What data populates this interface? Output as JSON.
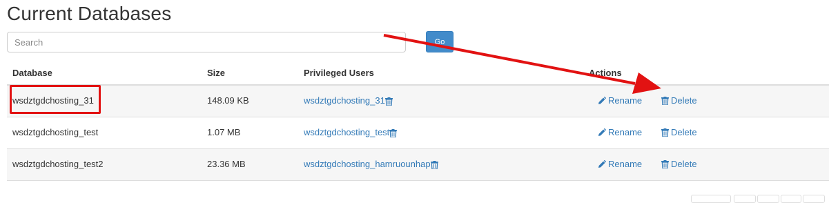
{
  "page": {
    "title": "Current Databases"
  },
  "search": {
    "placeholder": "Search",
    "value": "",
    "go_label": "Go"
  },
  "table": {
    "headers": {
      "database": "Database",
      "size": "Size",
      "users": "Privileged Users",
      "actions": "Actions"
    },
    "rows": [
      {
        "database": "wsdztgdchosting_31",
        "size": "148.09 KB",
        "user": "wsdztgdchosting_31",
        "rename": "Rename",
        "delete": "Delete"
      },
      {
        "database": "wsdztgdchosting_test",
        "size": "1.07 MB",
        "user": "wsdztgdchosting_test",
        "rename": "Rename",
        "delete": "Delete"
      },
      {
        "database": "wsdztgdchosting_test2",
        "size": "23.36 MB",
        "user": "wsdztgdchosting_hamruounhap",
        "rename": "Rename",
        "delete": "Delete"
      }
    ]
  },
  "icons": {
    "user_delete": "trash-icon",
    "rename": "pencil-icon",
    "delete": "trash-icon"
  },
  "colors": {
    "link": "#337ab7",
    "go_button": "#428bca",
    "annotation": "#e21212"
  }
}
